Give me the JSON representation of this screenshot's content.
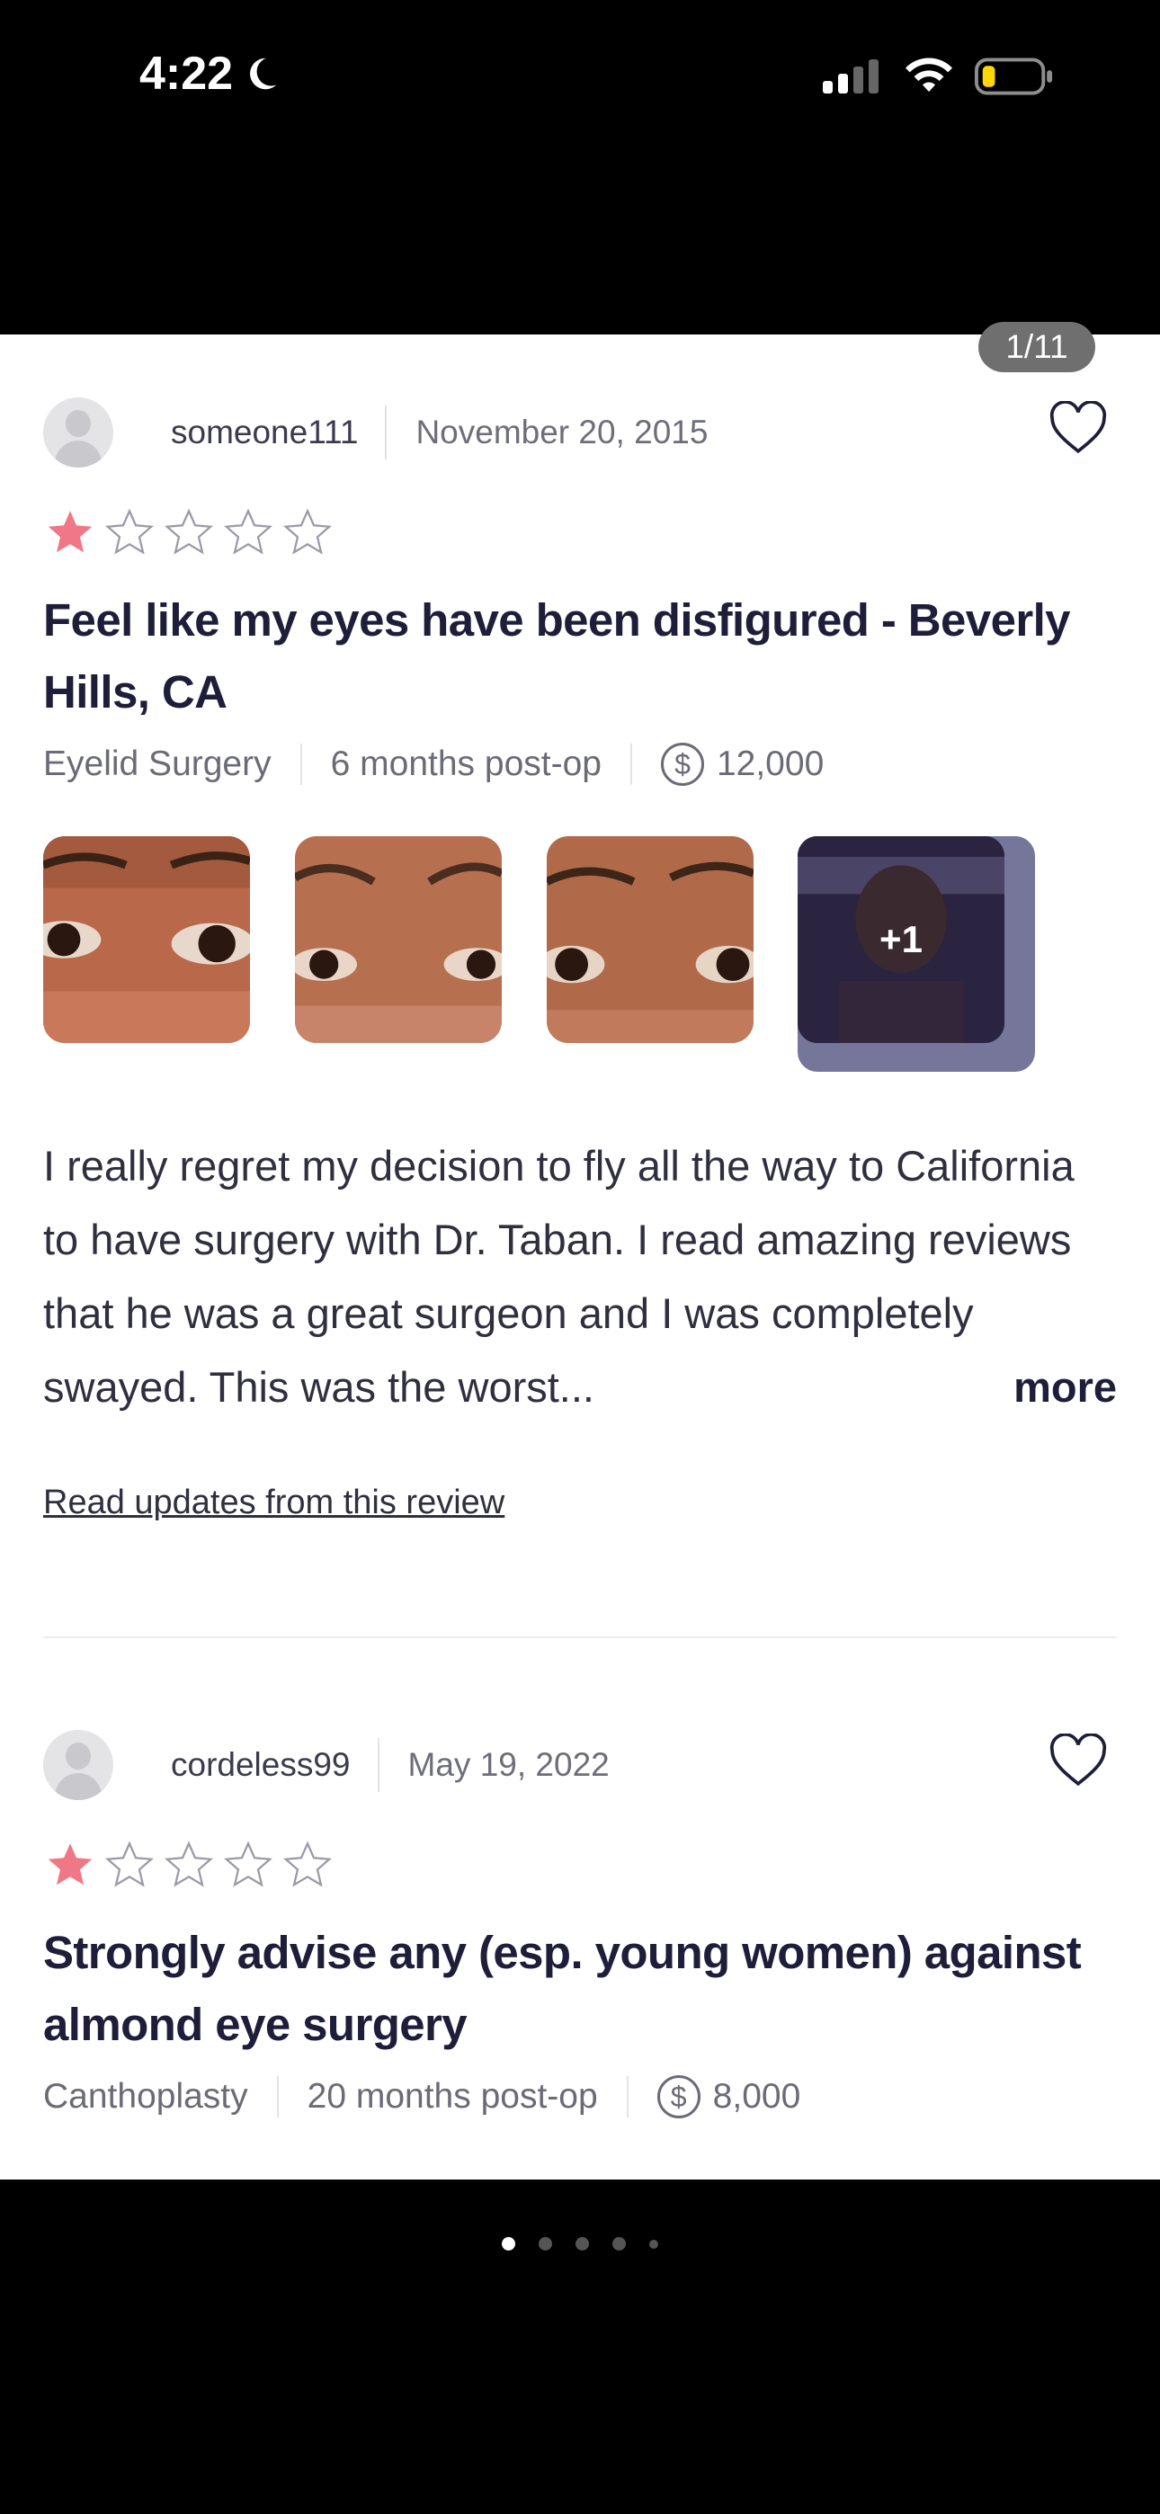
{
  "status_bar": {
    "time": "4:22"
  },
  "pager": {
    "label": "1/11"
  },
  "colors": {
    "star_filled": "#f07886",
    "star_empty": "#9a9aa8",
    "title_text": "#1e1e3a"
  },
  "reviews": [
    {
      "username": "someone111",
      "date": "November 20, 2015",
      "rating": 1,
      "title": "Feel like my eyes have been disfigured - Beverly Hills, CA",
      "procedure": "Eyelid Surgery",
      "post_op": "6 months post-op",
      "cost": "12,000",
      "photos_more_label": "+1",
      "body": "I really regret my decision to fly all the way to California to have surgery with Dr. Taban. I read amazing reviews that he was a great surgeon and I was completely swayed. This was the worst...",
      "more_label": "more",
      "updates_link": "Read updates from this review"
    },
    {
      "username": "cordeless99",
      "date": "May 19, 2022",
      "rating": 1,
      "title": "Strongly advise any (esp. young women) against almond eye surgery",
      "procedure": "Canthoplasty",
      "post_op": "20 months post-op",
      "cost": "8,000"
    }
  ],
  "page_indicator": {
    "count": 5,
    "active_index": 0
  }
}
